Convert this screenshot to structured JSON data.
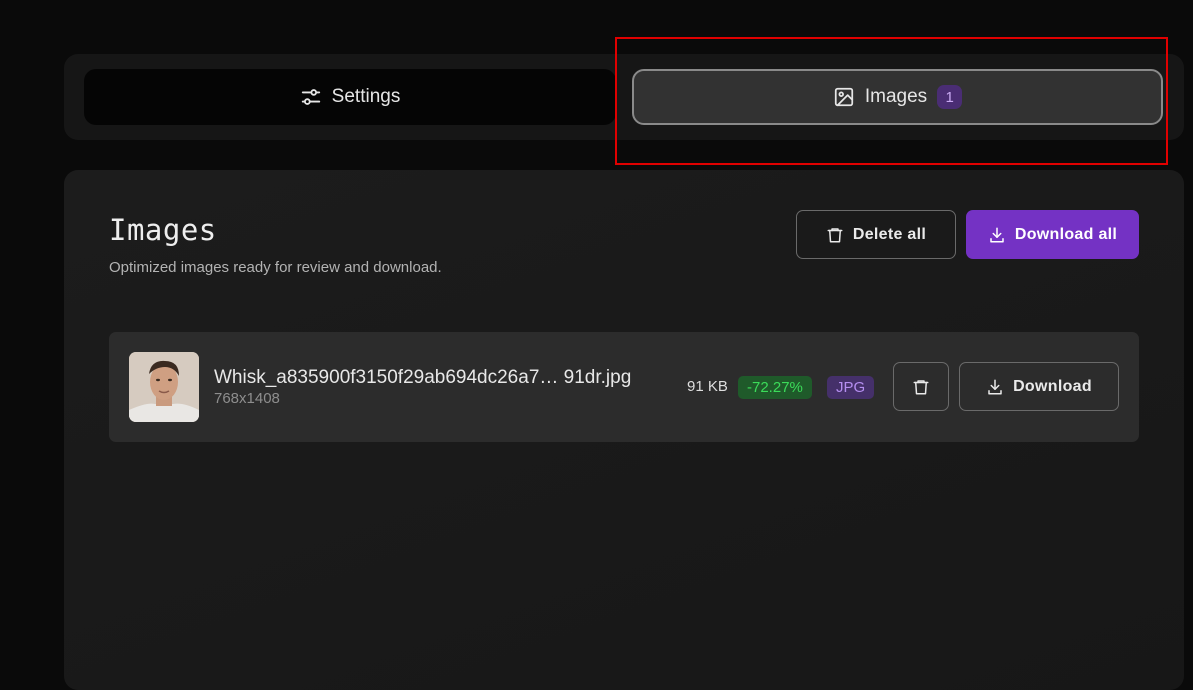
{
  "tabs": {
    "settings": {
      "label": "Settings",
      "icon": "sliders-icon"
    },
    "images": {
      "label": "Images",
      "icon": "image-icon",
      "count": "1"
    }
  },
  "panel": {
    "title": "Images",
    "subtitle": "Optimized images ready for review and download.",
    "delete_all_label": "Delete all",
    "download_all_label": "Download all"
  },
  "files": [
    {
      "name": "Whisk_a835900f3150f29ab694dc26a7… 91dr.jpg",
      "dimensions": "768x1408",
      "size": "91 KB",
      "savings": "-72.27%",
      "format": "JPG",
      "download_label": "Download"
    }
  ],
  "colors": {
    "accent": "#7432c4",
    "savings": "#3bdb59",
    "format": "#b58ef0",
    "highlight": "#e00000"
  }
}
